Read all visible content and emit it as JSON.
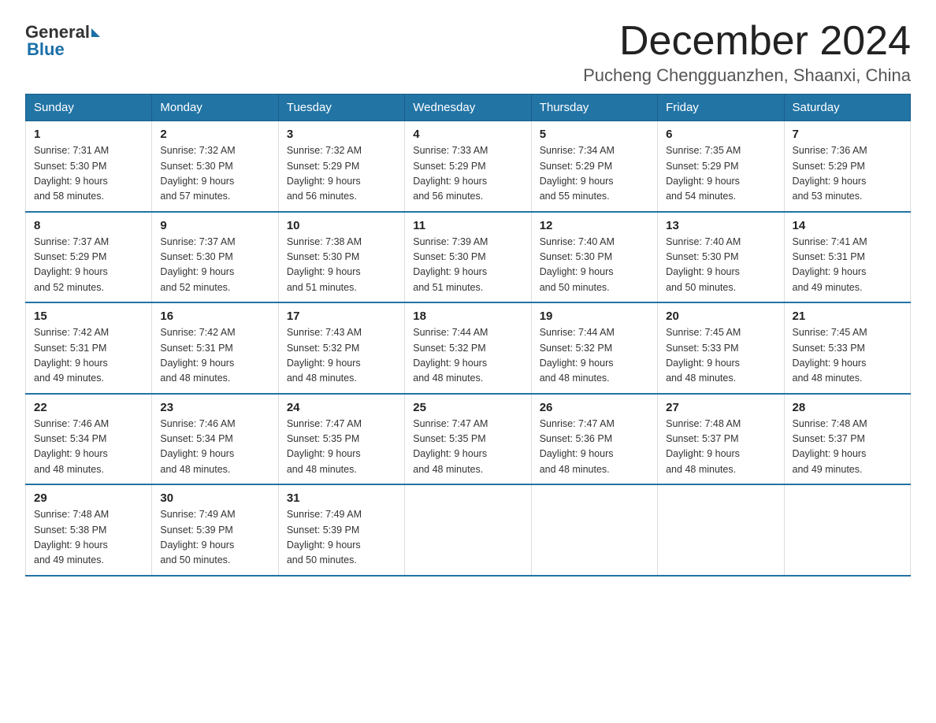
{
  "header": {
    "logo_general": "General",
    "logo_blue": "Blue",
    "month_title": "December 2024",
    "location": "Pucheng Chengguanzhen, Shaanxi, China"
  },
  "weekdays": [
    "Sunday",
    "Monday",
    "Tuesday",
    "Wednesday",
    "Thursday",
    "Friday",
    "Saturday"
  ],
  "weeks": [
    [
      {
        "day": "1",
        "sunrise": "7:31 AM",
        "sunset": "5:30 PM",
        "daylight": "9 hours and 58 minutes."
      },
      {
        "day": "2",
        "sunrise": "7:32 AM",
        "sunset": "5:30 PM",
        "daylight": "9 hours and 57 minutes."
      },
      {
        "day": "3",
        "sunrise": "7:32 AM",
        "sunset": "5:29 PM",
        "daylight": "9 hours and 56 minutes."
      },
      {
        "day": "4",
        "sunrise": "7:33 AM",
        "sunset": "5:29 PM",
        "daylight": "9 hours and 56 minutes."
      },
      {
        "day": "5",
        "sunrise": "7:34 AM",
        "sunset": "5:29 PM",
        "daylight": "9 hours and 55 minutes."
      },
      {
        "day": "6",
        "sunrise": "7:35 AM",
        "sunset": "5:29 PM",
        "daylight": "9 hours and 54 minutes."
      },
      {
        "day": "7",
        "sunrise": "7:36 AM",
        "sunset": "5:29 PM",
        "daylight": "9 hours and 53 minutes."
      }
    ],
    [
      {
        "day": "8",
        "sunrise": "7:37 AM",
        "sunset": "5:29 PM",
        "daylight": "9 hours and 52 minutes."
      },
      {
        "day": "9",
        "sunrise": "7:37 AM",
        "sunset": "5:30 PM",
        "daylight": "9 hours and 52 minutes."
      },
      {
        "day": "10",
        "sunrise": "7:38 AM",
        "sunset": "5:30 PM",
        "daylight": "9 hours and 51 minutes."
      },
      {
        "day": "11",
        "sunrise": "7:39 AM",
        "sunset": "5:30 PM",
        "daylight": "9 hours and 51 minutes."
      },
      {
        "day": "12",
        "sunrise": "7:40 AM",
        "sunset": "5:30 PM",
        "daylight": "9 hours and 50 minutes."
      },
      {
        "day": "13",
        "sunrise": "7:40 AM",
        "sunset": "5:30 PM",
        "daylight": "9 hours and 50 minutes."
      },
      {
        "day": "14",
        "sunrise": "7:41 AM",
        "sunset": "5:31 PM",
        "daylight": "9 hours and 49 minutes."
      }
    ],
    [
      {
        "day": "15",
        "sunrise": "7:42 AM",
        "sunset": "5:31 PM",
        "daylight": "9 hours and 49 minutes."
      },
      {
        "day": "16",
        "sunrise": "7:42 AM",
        "sunset": "5:31 PM",
        "daylight": "9 hours and 48 minutes."
      },
      {
        "day": "17",
        "sunrise": "7:43 AM",
        "sunset": "5:32 PM",
        "daylight": "9 hours and 48 minutes."
      },
      {
        "day": "18",
        "sunrise": "7:44 AM",
        "sunset": "5:32 PM",
        "daylight": "9 hours and 48 minutes."
      },
      {
        "day": "19",
        "sunrise": "7:44 AM",
        "sunset": "5:32 PM",
        "daylight": "9 hours and 48 minutes."
      },
      {
        "day": "20",
        "sunrise": "7:45 AM",
        "sunset": "5:33 PM",
        "daylight": "9 hours and 48 minutes."
      },
      {
        "day": "21",
        "sunrise": "7:45 AM",
        "sunset": "5:33 PM",
        "daylight": "9 hours and 48 minutes."
      }
    ],
    [
      {
        "day": "22",
        "sunrise": "7:46 AM",
        "sunset": "5:34 PM",
        "daylight": "9 hours and 48 minutes."
      },
      {
        "day": "23",
        "sunrise": "7:46 AM",
        "sunset": "5:34 PM",
        "daylight": "9 hours and 48 minutes."
      },
      {
        "day": "24",
        "sunrise": "7:47 AM",
        "sunset": "5:35 PM",
        "daylight": "9 hours and 48 minutes."
      },
      {
        "day": "25",
        "sunrise": "7:47 AM",
        "sunset": "5:35 PM",
        "daylight": "9 hours and 48 minutes."
      },
      {
        "day": "26",
        "sunrise": "7:47 AM",
        "sunset": "5:36 PM",
        "daylight": "9 hours and 48 minutes."
      },
      {
        "day": "27",
        "sunrise": "7:48 AM",
        "sunset": "5:37 PM",
        "daylight": "9 hours and 48 minutes."
      },
      {
        "day": "28",
        "sunrise": "7:48 AM",
        "sunset": "5:37 PM",
        "daylight": "9 hours and 49 minutes."
      }
    ],
    [
      {
        "day": "29",
        "sunrise": "7:48 AM",
        "sunset": "5:38 PM",
        "daylight": "9 hours and 49 minutes."
      },
      {
        "day": "30",
        "sunrise": "7:49 AM",
        "sunset": "5:39 PM",
        "daylight": "9 hours and 50 minutes."
      },
      {
        "day": "31",
        "sunrise": "7:49 AM",
        "sunset": "5:39 PM",
        "daylight": "9 hours and 50 minutes."
      },
      null,
      null,
      null,
      null
    ]
  ]
}
